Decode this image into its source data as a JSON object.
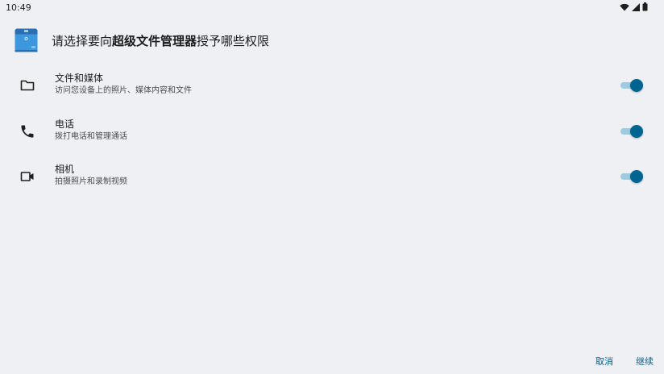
{
  "status_bar": {
    "time": "10:49",
    "icons": [
      "wifi-icon",
      "signal-icon",
      "battery-icon"
    ]
  },
  "header": {
    "title_prefix": "请选择要向",
    "app_name": "超级文件管理器",
    "title_suffix": "授予哪些权限",
    "app_icon": "file-manager-app-icon"
  },
  "permissions": [
    {
      "icon": "folder-icon",
      "title": "文件和媒体",
      "description": "访问您设备上的照片、媒体内容和文件",
      "enabled": true
    },
    {
      "icon": "phone-icon",
      "title": "电话",
      "description": "拨打电话和管理通话",
      "enabled": true
    },
    {
      "icon": "camera-icon",
      "title": "相机",
      "description": "拍摄照片和录制视频",
      "enabled": true
    }
  ],
  "buttons": {
    "cancel": "取消",
    "continue": "继续"
  },
  "colors": {
    "background": "#eff0f3",
    "accent": "#006491",
    "toggle_track": "#9ecbe0",
    "button_text": "#0a6088"
  }
}
